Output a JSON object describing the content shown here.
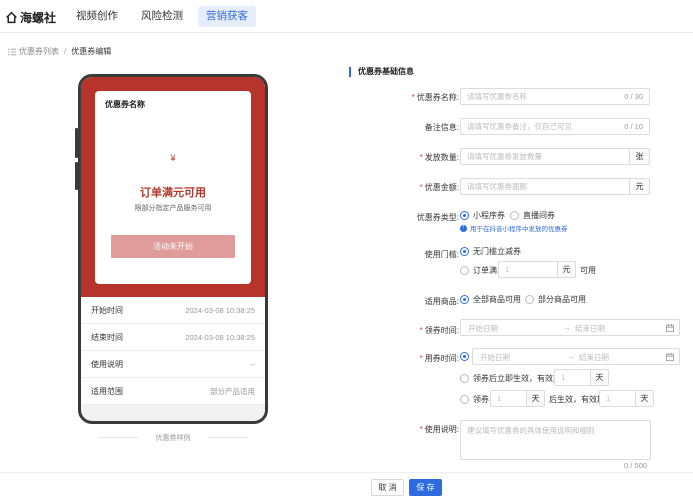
{
  "nav": {
    "brand": "海螺社",
    "tabs": [
      {
        "label": "视频创作"
      },
      {
        "label": "风险检测"
      },
      {
        "label": "营销获客"
      }
    ]
  },
  "breadcrumb": {
    "parent": "优惠券列表",
    "separator": "/",
    "current": "优惠券编辑"
  },
  "preview": {
    "card_title": "优惠券名称",
    "currency": "¥",
    "main_text": "订单满元可用",
    "sub_text": "限部分指定产品服务可用",
    "button_label": "活动未开始",
    "rows": [
      {
        "label": "开始时间",
        "value": "2024-03-08 10:38:25"
      },
      {
        "label": "结束时间",
        "value": "2024-03-08 10:38:25"
      },
      {
        "label": "使用说明",
        "value": "--"
      },
      {
        "label": "适用范围",
        "value": "部分产品适用"
      }
    ],
    "sample_label": "优惠券样例"
  },
  "form": {
    "section_title": "优惠券基础信息",
    "name": {
      "label": "优惠券名称:",
      "placeholder": "请填写优惠券名称",
      "count": "0 / 30"
    },
    "remark": {
      "label": "备注信息:",
      "placeholder": "请填写优惠券备注，仅自己可见",
      "count": "0 / 10"
    },
    "quantity": {
      "label": "发放数量:",
      "placeholder": "请填写优惠券发放数量",
      "suffix": "张"
    },
    "amount": {
      "label": "优惠金额:",
      "placeholder": "请填写优惠券面额",
      "suffix": "元"
    },
    "type": {
      "label": "优惠券类型:",
      "options": [
        "小程序券",
        "直播间券"
      ],
      "hint": "用于在抖音小程序中发放的优惠券"
    },
    "threshold": {
      "label": "使用门槛:",
      "option_none": "无门槛立减券",
      "option_full": "订单满",
      "full_value": "1",
      "full_unit": "元",
      "full_tail": "可用"
    },
    "scope": {
      "label": "适用商品:",
      "options": [
        "全部商品可用",
        "部分商品可用"
      ]
    },
    "claim_time": {
      "label": "领券时间:",
      "start": "开始日期",
      "arrow": "→",
      "end": "结束日期"
    },
    "use_time": {
      "label": "用券时间:",
      "start": "开始日期",
      "arrow": "→",
      "end": "结束日期",
      "opt2_prefix": "领券后立即生效，有效期",
      "opt2_value": "1",
      "opt2_unit": "天",
      "opt3_prefix": "领券",
      "opt3_value1": "1",
      "opt3_unit1": "天",
      "opt3_mid": "后生效，有效期",
      "opt3_value2": "1",
      "opt3_unit2": "天"
    },
    "desc": {
      "label": "使用说明:",
      "placeholder": "建议填写优惠券的具体使用说明和细则",
      "count": "0 / 500"
    }
  },
  "footer": {
    "cancel": "取 消",
    "save": "保 存"
  },
  "colors": {
    "accent": "#2f6be0",
    "coupon_red": "#b7342c",
    "required": "#ee3333"
  }
}
